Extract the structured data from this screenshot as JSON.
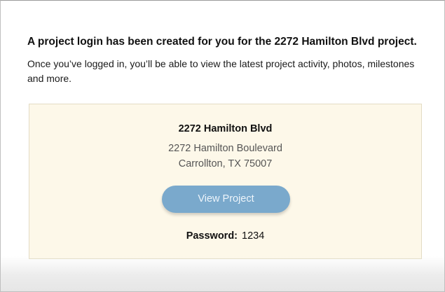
{
  "email": {
    "headline": "A project login has been created for you for the 2272 Hamilton Blvd project.",
    "intro": "Once you’ve logged in, you’ll be able to view the latest project activity, photos, milestones and more."
  },
  "card": {
    "title": "2272 Hamilton Blvd",
    "address_line1": "2272 Hamilton Boulevard",
    "address_line2": "Carrollton, TX 75007",
    "button_label": "View Project",
    "password_label": "Password:",
    "password_value": "1234"
  },
  "colors": {
    "card_background": "#fdf8e9",
    "button": "#7aa9cc"
  }
}
